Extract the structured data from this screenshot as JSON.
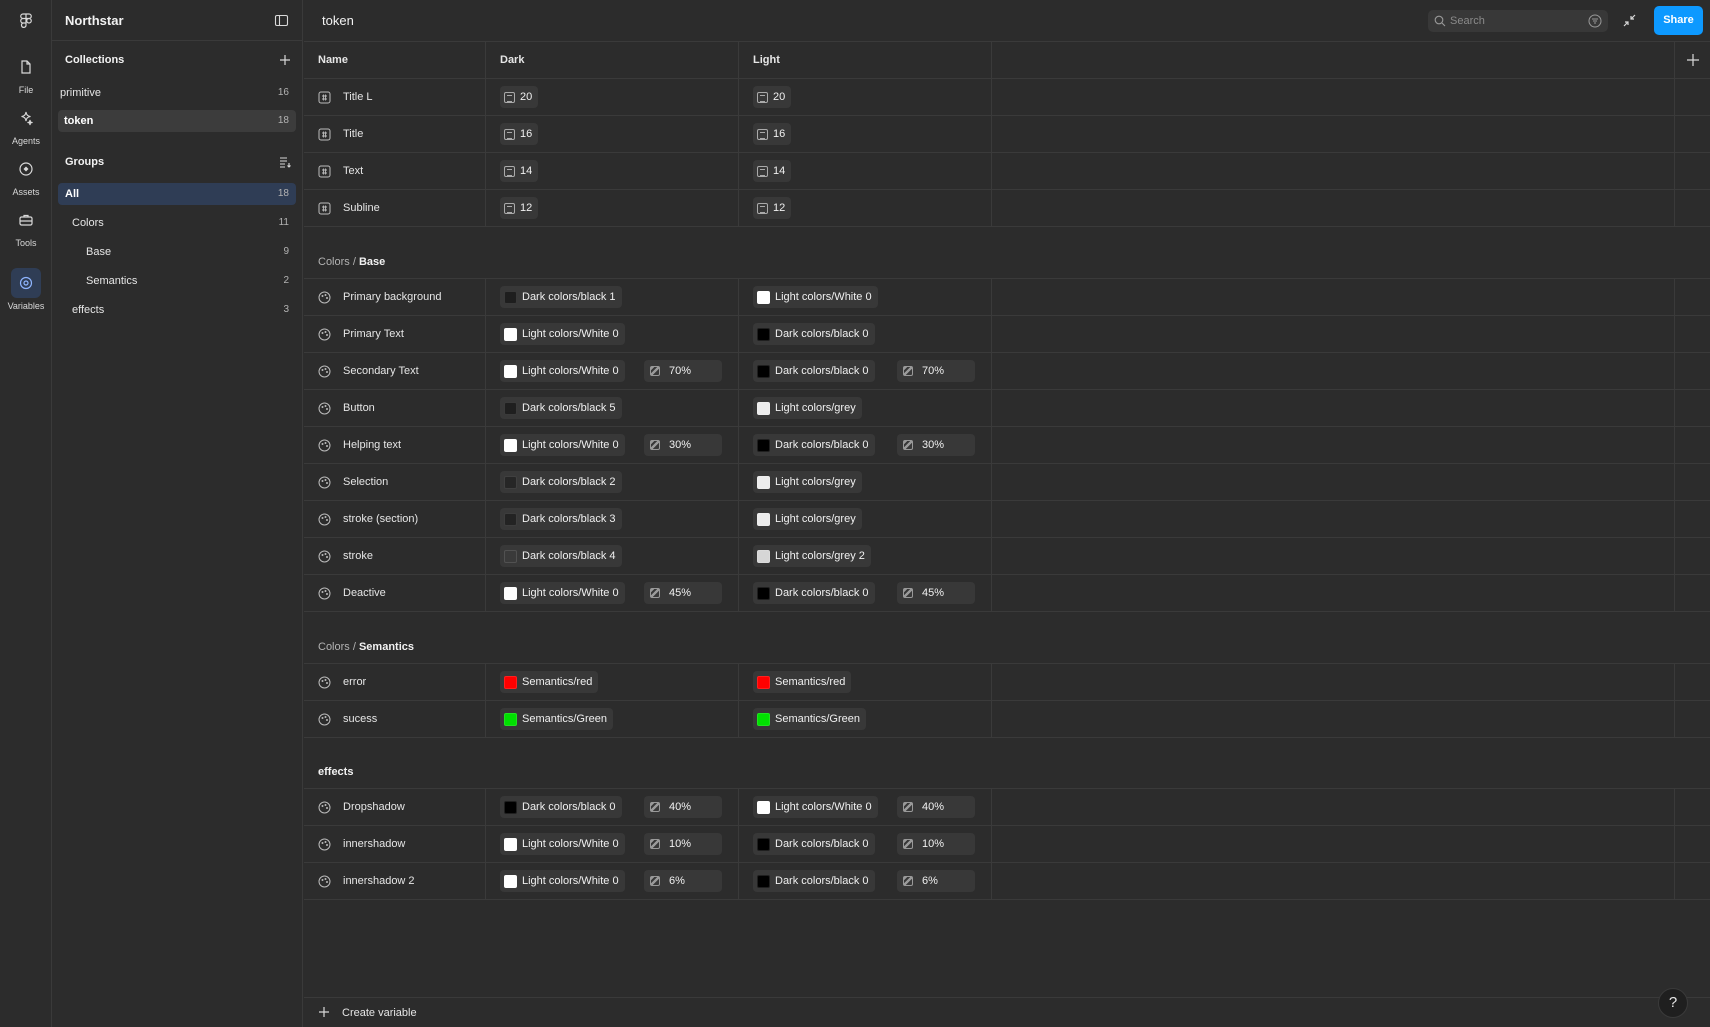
{
  "rail": {
    "items": [
      {
        "label": "File",
        "icon": "file-icon"
      },
      {
        "label": "Agents",
        "icon": "sparkle-icon"
      },
      {
        "label": "Assets",
        "icon": "assets-icon"
      },
      {
        "label": "Tools",
        "icon": "toolbox-icon"
      },
      {
        "label": "Variables",
        "icon": "variables-icon"
      }
    ]
  },
  "sidebar": {
    "title": "Northstar",
    "collections_label": "Collections",
    "collections": [
      {
        "label": "primitive",
        "count": "16"
      },
      {
        "label": "token",
        "count": "18"
      }
    ],
    "groups_label": "Groups",
    "groups": [
      {
        "label": "All",
        "count": "18"
      },
      {
        "label": "Colors",
        "count": "11"
      },
      {
        "label": "Base",
        "count": "9"
      },
      {
        "label": "Semantics",
        "count": "2"
      },
      {
        "label": "effects",
        "count": "3"
      }
    ]
  },
  "topbar": {
    "title": "token",
    "search_placeholder": "Search",
    "share_label": "Share"
  },
  "table": {
    "headers": {
      "name": "Name",
      "dark": "Dark",
      "light": "Light"
    },
    "number_rows": [
      {
        "name": "Title L",
        "dark": "20",
        "light": "20"
      },
      {
        "name": "Title",
        "dark": "16",
        "light": "16"
      },
      {
        "name": "Text",
        "dark": "14",
        "light": "14"
      },
      {
        "name": "Subline",
        "dark": "12",
        "light": "12"
      }
    ],
    "base_group": {
      "prefix": "Colors / ",
      "name": "Base"
    },
    "base_rows": [
      {
        "name": "Primary background",
        "dark": {
          "label": "Dark colors/black 1",
          "color": "#1e1e1e",
          "opacity": ""
        },
        "light": {
          "label": "Light colors/White 0",
          "color": "#ffffff",
          "opacity": ""
        }
      },
      {
        "name": "Primary Text",
        "dark": {
          "label": "Light colors/White 0",
          "color": "#ffffff",
          "opacity": ""
        },
        "light": {
          "label": "Dark colors/black 0",
          "color": "#000000",
          "opacity": ""
        }
      },
      {
        "name": "Secondary Text",
        "dark": {
          "label": "Light colors/White 0",
          "color": "#ffffff",
          "opacity": "70%"
        },
        "light": {
          "label": "Dark colors/black 0",
          "color": "#000000",
          "opacity": "70%"
        }
      },
      {
        "name": "Button",
        "dark": {
          "label": "Dark colors/black 5",
          "color": "#1f1f1f",
          "opacity": ""
        },
        "light": {
          "label": "Light colors/grey",
          "color": "#ececec",
          "opacity": ""
        }
      },
      {
        "name": "Helping text",
        "dark": {
          "label": "Light colors/White 0",
          "color": "#ffffff",
          "opacity": "30%"
        },
        "light": {
          "label": "Dark colors/black 0",
          "color": "#000000",
          "opacity": "30%"
        }
      },
      {
        "name": "Selection",
        "dark": {
          "label": "Dark colors/black 2",
          "color": "#262626",
          "opacity": ""
        },
        "light": {
          "label": "Light colors/grey",
          "color": "#ececec",
          "opacity": ""
        }
      },
      {
        "name": "stroke (section)",
        "dark": {
          "label": "Dark colors/black 3",
          "color": "#232323",
          "opacity": ""
        },
        "light": {
          "label": "Light colors/grey",
          "color": "#ececec",
          "opacity": ""
        }
      },
      {
        "name": "stroke",
        "dark": {
          "label": "Dark colors/black 4",
          "color": "#3a3a3a",
          "opacity": ""
        },
        "light": {
          "label": "Light colors/grey 2",
          "color": "#d6d6d6",
          "opacity": ""
        }
      },
      {
        "name": "Deactive",
        "dark": {
          "label": "Light colors/White 0",
          "color": "#ffffff",
          "opacity": "45%"
        },
        "light": {
          "label": "Dark colors/black 0",
          "color": "#000000",
          "opacity": "45%"
        }
      }
    ],
    "semantics_group": {
      "prefix": "Colors / ",
      "name": "Semantics"
    },
    "semantics_rows": [
      {
        "name": "error",
        "dark": {
          "label": "Semantics/red",
          "color": "#ff0000",
          "opacity": ""
        },
        "light": {
          "label": "Semantics/red",
          "color": "#ff0000",
          "opacity": ""
        }
      },
      {
        "name": "sucess",
        "dark": {
          "label": "Semantics/Green",
          "color": "#00e000",
          "opacity": ""
        },
        "light": {
          "label": "Semantics/Green",
          "color": "#00e000",
          "opacity": ""
        }
      }
    ],
    "effects_group": {
      "prefix": "",
      "name": "effects"
    },
    "effects_rows": [
      {
        "name": "Dropshadow",
        "dark": {
          "label": "Dark colors/black 0",
          "color": "#000000",
          "opacity": "40%"
        },
        "light": {
          "label": "Light colors/White 0",
          "color": "#ffffff",
          "opacity": "40%"
        }
      },
      {
        "name": "innershadow",
        "dark": {
          "label": "Light colors/White 0",
          "color": "#ffffff",
          "opacity": "10%"
        },
        "light": {
          "label": "Dark colors/black 0",
          "color": "#000000",
          "opacity": "10%"
        }
      },
      {
        "name": "innershadow 2",
        "dark": {
          "label": "Light colors/White 0",
          "color": "#ffffff",
          "opacity": "6%"
        },
        "light": {
          "label": "Dark colors/black 0",
          "color": "#000000",
          "opacity": "6%"
        }
      }
    ]
  },
  "footer": {
    "create_label": "Create variable"
  },
  "help": {
    "label": "?"
  },
  "colors": {
    "accent": "#0d99ff",
    "selection": "#2f3d55",
    "background": "#2c2c2c",
    "border": "#3a3a3a"
  }
}
